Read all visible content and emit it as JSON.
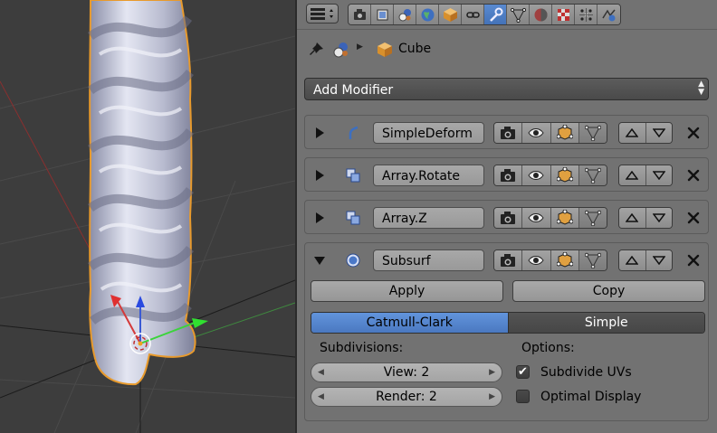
{
  "properties": {
    "context": {
      "object_name": "Cube"
    },
    "add_modifier": "Add Modifier",
    "modifiers": [
      {
        "name": "SimpleDeform",
        "expanded": false,
        "icon": "simple-deform-icon"
      },
      {
        "name": "Array.Rotate",
        "expanded": false,
        "icon": "array-icon"
      },
      {
        "name": "Array.Z",
        "expanded": false,
        "icon": "array-icon"
      },
      {
        "name": "Subsurf",
        "expanded": true,
        "icon": "subsurf-icon"
      }
    ],
    "subsurf": {
      "apply_label": "Apply",
      "copy_label": "Copy",
      "algorithms": [
        "Catmull-Clark",
        "Simple"
      ],
      "selected_algorithm": "Catmull-Clark",
      "subdivisions_label": "Subdivisions:",
      "view_field": "View: 2",
      "render_field": "Render: 2",
      "options_label": "Options:",
      "subdivide_uvs": {
        "label": "Subdivide UVs",
        "checked": true
      },
      "optimal_display": {
        "label": "Optimal Display",
        "checked": false
      }
    },
    "tabs": [
      "render-icon",
      "render-layers-icon",
      "scene-icon",
      "world-icon",
      "object-icon",
      "constraints-icon",
      "modifiers-icon",
      "data-icon",
      "material-icon",
      "texture-icon",
      "particles-icon",
      "physics-icon"
    ],
    "active_tab": "modifiers-icon"
  },
  "colors": {
    "accent": "#5585d0",
    "viewport_bg": "#3d3d3d",
    "panel_bg": "#727272",
    "selection_outline": "#e89a2c"
  }
}
